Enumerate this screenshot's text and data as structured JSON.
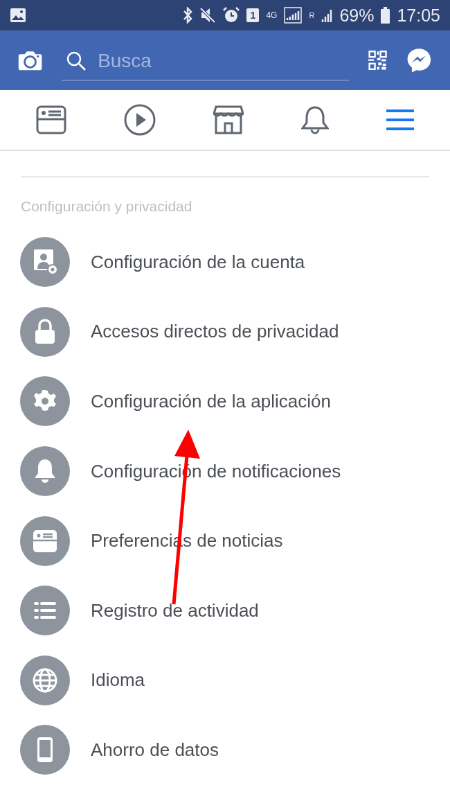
{
  "status_bar": {
    "sim": "1",
    "network": "4G",
    "roaming": "R",
    "battery": "69%",
    "time": "17:05"
  },
  "header": {
    "search": {
      "placeholder": "Busca"
    }
  },
  "tabs": [
    {
      "kind": "feed",
      "selected": false
    },
    {
      "kind": "video",
      "selected": false
    },
    {
      "kind": "marketplace",
      "selected": false
    },
    {
      "kind": "notifications",
      "selected": false
    },
    {
      "kind": "menu",
      "selected": true
    }
  ],
  "section": {
    "title": "Configuración y privacidad",
    "items": [
      {
        "kind": "account",
        "label": "Configuración de la cuenta"
      },
      {
        "kind": "privacy",
        "label": "Accesos directos de privacidad"
      },
      {
        "kind": "app",
        "label": "Configuración de la aplicación"
      },
      {
        "kind": "notifications",
        "label": "Configuración de notificaciones"
      },
      {
        "kind": "feed",
        "label": "Preferencias de noticias"
      },
      {
        "kind": "activity",
        "label": "Registro de actividad"
      },
      {
        "kind": "language",
        "label": "Idioma"
      },
      {
        "kind": "data",
        "label": "Ahorro de datos"
      }
    ]
  }
}
